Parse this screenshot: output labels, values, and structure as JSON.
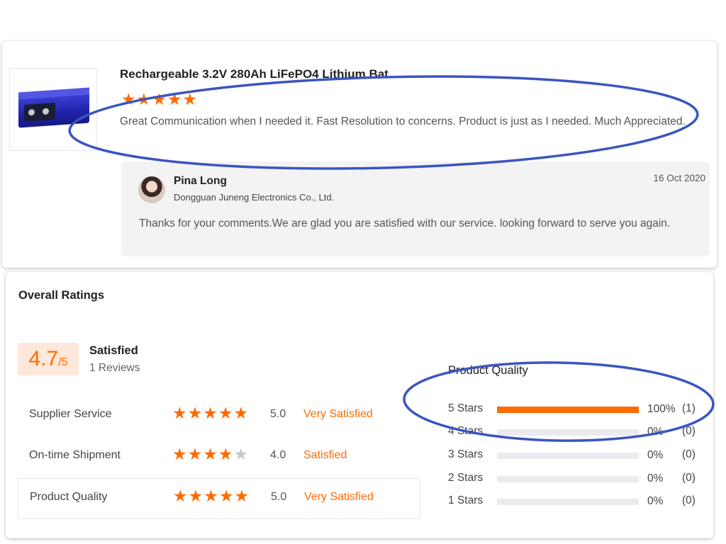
{
  "review": {
    "product_title": "Rechargeable 3.2V 280Ah LiFePO4 Lithium Bat...",
    "stars": 5,
    "text": "Great Communication when I needed it. Fast Resolution to concerns. Product is just as I needed. Much Appreciated.",
    "reply": {
      "name": "Pina Long",
      "company": "Dongguan Juneng Electronics Co., Ltd.",
      "date": "16 Oct 2020",
      "text": "Thanks for your comments.We are glad you are satisfied with our service.  looking forward to serve you again."
    }
  },
  "overall": {
    "title": "Overall Ratings",
    "score": "4.7",
    "score_suffix": "/5",
    "label": "Satisfied",
    "reviews": "1 Reviews",
    "rows": [
      {
        "label": "Supplier Service",
        "stars": 5,
        "score": "5.0",
        "text": "Very Satisfied"
      },
      {
        "label": "On-time Shipment",
        "stars": 4,
        "score": "4.0",
        "text": "Satisfied"
      },
      {
        "label": "Product Quality",
        "stars": 5,
        "score": "5.0",
        "text": "Very Satisfied"
      }
    ],
    "product_quality": {
      "title": "Product Quality",
      "bars": [
        {
          "label": "5  Stars",
          "fraction": 1.0,
          "pct": "100%",
          "count": "(1)"
        },
        {
          "label": "4  Stars",
          "fraction": 0,
          "pct": "0%",
          "count": "(0)"
        },
        {
          "label": "3  Stars",
          "fraction": 0,
          "pct": "0%",
          "count": "(0)"
        },
        {
          "label": "2  Stars",
          "fraction": 0,
          "pct": "0%",
          "count": "(0)"
        },
        {
          "label": "1  Stars",
          "fraction": 0,
          "pct": "0%",
          "count": "(0)"
        }
      ]
    }
  },
  "colors": {
    "accent": "#ff6a00",
    "annotation": "#3a55c0",
    "star_empty": "#c8c8cc"
  },
  "icons": {
    "star": "star-icon"
  }
}
